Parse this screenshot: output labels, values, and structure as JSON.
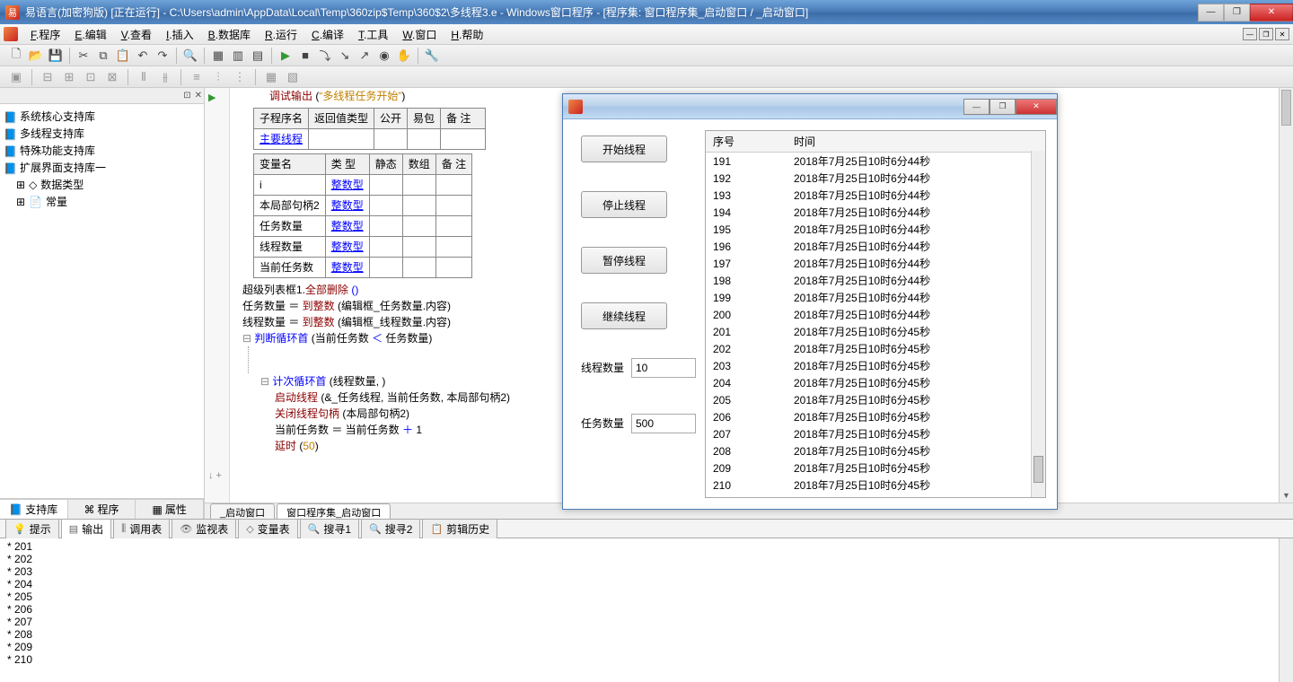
{
  "titlebar": {
    "text": "易语言(加密狗版) [正在运行] - C:\\Users\\admin\\AppData\\Local\\Temp\\360zip$Temp\\360$2\\多线程3.e - Windows窗口程序 - [程序集: 窗口程序集_启动窗口 / _启动窗口]"
  },
  "menu": [
    "F.程序",
    "E.编辑",
    "V.查看",
    "I.插入",
    "B.数据库",
    "R.运行",
    "C.编译",
    "T.工具",
    "W.窗口",
    "H.帮助"
  ],
  "sidebar": {
    "items": [
      "系统核心支持库",
      "多线程支持库",
      "特殊功能支持库",
      "扩展界面支持库一"
    ],
    "sub": [
      {
        "icon": "⊞",
        "label": "数据类型"
      },
      {
        "icon": "⊞",
        "label": "常量"
      }
    ],
    "tabs": [
      "支持库",
      "程序",
      "属性"
    ]
  },
  "code": {
    "dbgcall": "调试输出",
    "dbgarg": "“多线程任务开始”",
    "t1": {
      "head": [
        "子程序名",
        "返回值类型",
        "公开",
        "易包",
        "备 注"
      ],
      "row": [
        "主要线程",
        "",
        "",
        "",
        ""
      ]
    },
    "t2": {
      "head": [
        "变量名",
        "类 型",
        "静态",
        "数组",
        "备 注"
      ],
      "rows": [
        [
          "i",
          "整数型",
          "",
          "",
          ""
        ],
        [
          "本局部句柄2",
          "整数型",
          "",
          "",
          ""
        ],
        [
          "任务数量",
          "整数型",
          "",
          "",
          ""
        ],
        [
          "线程数量",
          "整数型",
          "",
          "",
          ""
        ],
        [
          "当前任务数",
          "整数型",
          "",
          "",
          ""
        ]
      ]
    },
    "l1a": "超级列表框1.",
    "l1b": "全部删除",
    "l1c": "()",
    "l2": "任务数量  ＝  ",
    "l2f": "到整数",
    "l2a": " (编辑框_任务数量.内容)",
    "l3": "线程数量  ＝  ",
    "l3f": "到整数",
    "l3a": " (编辑框_线程数量.内容)",
    "l4": "判断循环首",
    "l4a": " (当前任务数 ",
    "l4op": "＜",
    "l4b": " 任务数量)",
    "l5": "计次循环首",
    "l5a": " (线程数量, )",
    "l6": "启动线程",
    "l6a": " (&_任务线程, 当前任务数, 本局部句柄2)",
    "l7": "关闭线程句柄",
    "l7a": " (本局部句柄2)",
    "l8": "当前任务数  ＝  当前任务数  ",
    "l8op": "＋",
    "l8n": "  1",
    "l9": "延时",
    "l9a": " (",
    "l9n": "50",
    "l9c": ")"
  },
  "editor_tabs": [
    "_启动窗口",
    "窗口程序集_启动窗口"
  ],
  "bottom_tabs": [
    "提示",
    "输出",
    "调用表",
    "监视表",
    "变量表",
    "搜寻1",
    "搜寻2",
    "剪辑历史"
  ],
  "output": [
    "* 201",
    "* 202",
    "* 203",
    "* 204",
    "* 205",
    "* 206",
    "* 207",
    "* 208",
    "* 209",
    "* 210"
  ],
  "dialog": {
    "btns": [
      "开始线程",
      "停止线程",
      "暂停线程",
      "继续线程"
    ],
    "fields": [
      {
        "label": "线程数量",
        "value": "10"
      },
      {
        "label": "任务数量",
        "value": "500"
      }
    ],
    "cols": [
      "序号",
      "时间"
    ],
    "rows": [
      [
        "191",
        "2018年7月25日10时6分44秒"
      ],
      [
        "192",
        "2018年7月25日10时6分44秒"
      ],
      [
        "193",
        "2018年7月25日10时6分44秒"
      ],
      [
        "194",
        "2018年7月25日10时6分44秒"
      ],
      [
        "195",
        "2018年7月25日10时6分44秒"
      ],
      [
        "196",
        "2018年7月25日10时6分44秒"
      ],
      [
        "197",
        "2018年7月25日10时6分44秒"
      ],
      [
        "198",
        "2018年7月25日10时6分44秒"
      ],
      [
        "199",
        "2018年7月25日10时6分44秒"
      ],
      [
        "200",
        "2018年7月25日10时6分44秒"
      ],
      [
        "201",
        "2018年7月25日10时6分45秒"
      ],
      [
        "202",
        "2018年7月25日10时6分45秒"
      ],
      [
        "203",
        "2018年7月25日10时6分45秒"
      ],
      [
        "204",
        "2018年7月25日10时6分45秒"
      ],
      [
        "205",
        "2018年7月25日10时6分45秒"
      ],
      [
        "206",
        "2018年7月25日10时6分45秒"
      ],
      [
        "207",
        "2018年7月25日10时6分45秒"
      ],
      [
        "208",
        "2018年7月25日10时6分45秒"
      ],
      [
        "209",
        "2018年7月25日10时6分45秒"
      ],
      [
        "210",
        "2018年7月25日10时6分45秒"
      ]
    ]
  }
}
